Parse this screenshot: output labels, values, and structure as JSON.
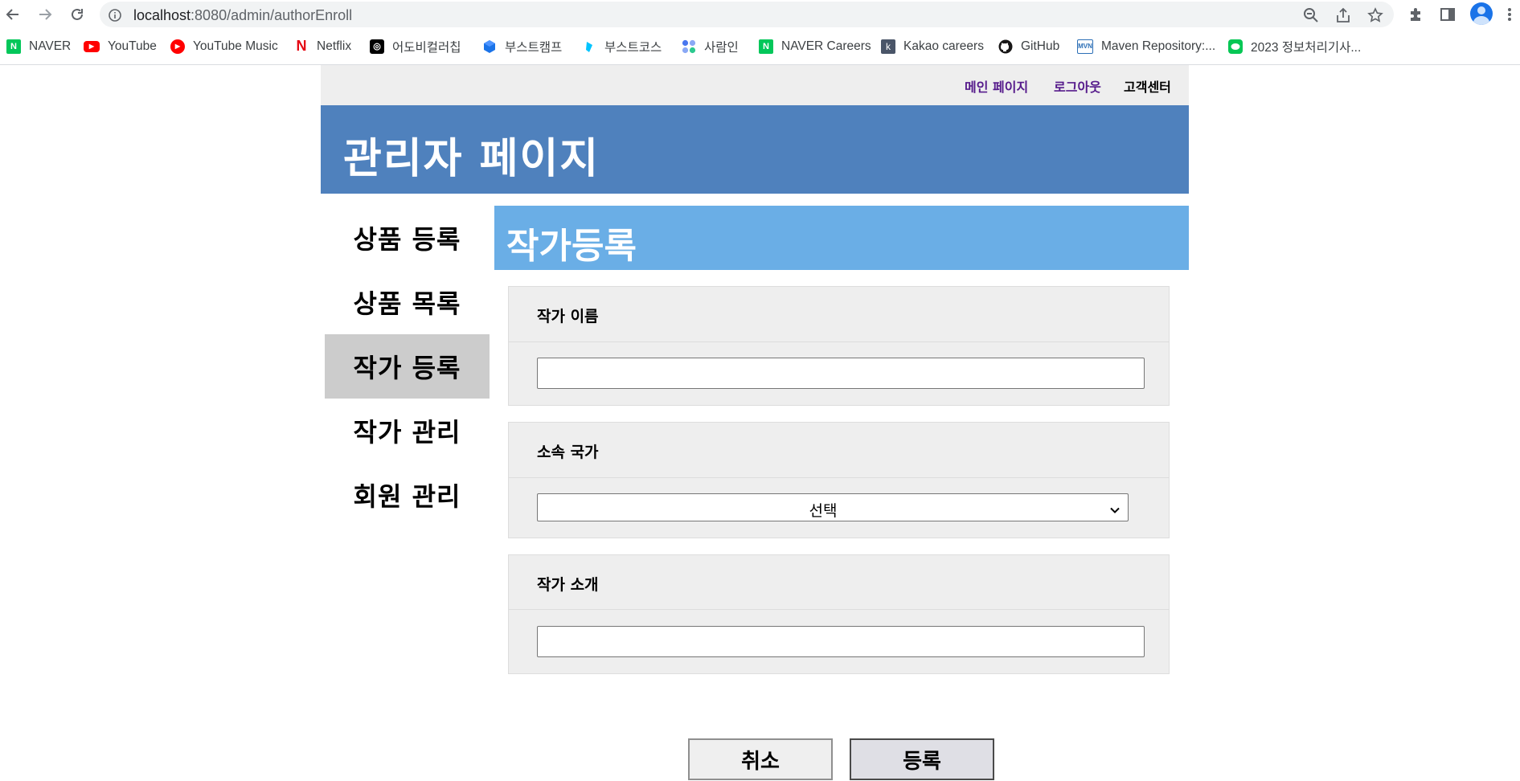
{
  "browser": {
    "url_host": "localhost",
    "url_rest": ":8080/admin/authorEnroll",
    "bookmarks": [
      {
        "label": "NAVER",
        "icon": "naver-icon",
        "glyph": "N",
        "color": "#03c75a"
      },
      {
        "label": "YouTube",
        "icon": "youtube-icon",
        "glyph": "▶",
        "color": "#ff0000"
      },
      {
        "label": "YouTube Music",
        "icon": "youtube-music-icon",
        "glyph": "▶",
        "color": "#ff0000"
      },
      {
        "label": "Netflix",
        "icon": "netflix-icon",
        "glyph": "N",
        "color": "#e50914"
      },
      {
        "label": "어도비컬러칩",
        "icon": "adobe-color-icon",
        "glyph": "◎",
        "color": "#000000"
      },
      {
        "label": "부스트캠프",
        "icon": "boostcamp-icon",
        "glyph": "",
        "color": "#1a73e8"
      },
      {
        "label": "부스트코스",
        "icon": "boostcourse-icon",
        "glyph": "",
        "color": "#00c4ff"
      },
      {
        "label": "사람인",
        "icon": "saramin-icon",
        "glyph": "",
        "color": "#4876ef"
      },
      {
        "label": "NAVER Careers",
        "icon": "naver-careers-icon",
        "glyph": "N",
        "color": "#03c75a"
      },
      {
        "label": "Kakao careers",
        "icon": "kakao-careers-icon",
        "glyph": "k",
        "color": "#4a5568"
      },
      {
        "label": "GitHub",
        "icon": "github-icon",
        "glyph": "",
        "color": "#181717"
      },
      {
        "label": "Maven Repository:...",
        "icon": "maven-icon",
        "glyph": "MVN",
        "color": "#2c6fb6"
      },
      {
        "label": "2023 정보처리기사...",
        "icon": "line-icon",
        "glyph": "",
        "color": "#06c755"
      }
    ]
  },
  "header": {
    "links": [
      "메인 페이지",
      "로그아웃",
      "고객센터"
    ],
    "title": "관리자 페이지"
  },
  "sidebar": {
    "items": [
      "상품 등록",
      "상품 목록",
      "작가 등록",
      "작가 관리",
      "회원 관리"
    ],
    "active_index": 2
  },
  "main": {
    "section_title": "작가등록",
    "fields": {
      "name_label": "작가 이름",
      "name_value": "",
      "nation_label": "소속 국가",
      "nation_selected": "선택",
      "intro_label": "작가 소개",
      "intro_value": ""
    },
    "buttons": {
      "cancel": "취소",
      "submit": "등록"
    }
  },
  "colors": {
    "banner": "#4f81bd",
    "section_head": "#6aaee6",
    "sidebar_active": "#cccccc",
    "field_bg": "#eeeeee"
  }
}
